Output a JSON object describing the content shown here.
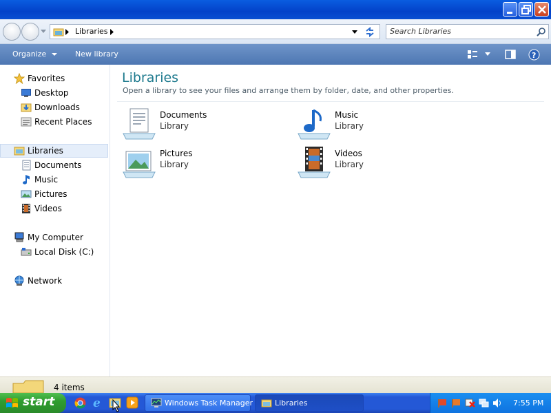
{
  "window": {
    "buttons": [
      "minimize",
      "maximize",
      "close"
    ]
  },
  "address": {
    "path_label": "Libraries",
    "search_placeholder": "Search Libraries"
  },
  "toolbar": {
    "organize_label": "Organize",
    "new_library_label": "New library"
  },
  "nav": {
    "favorites": "Favorites",
    "desktop": "Desktop",
    "downloads": "Downloads",
    "recent": "Recent Places",
    "libraries": "Libraries",
    "documents": "Documents",
    "music": "Music",
    "pictures": "Pictures",
    "videos": "Videos",
    "computer": "My Computer",
    "local_disk": "Local Disk (C:)",
    "network": "Network"
  },
  "content": {
    "title": "Libraries",
    "subtitle": "Open a library to see your files and arrange them by folder, date, and other properties.",
    "libraries": [
      {
        "name": "Documents",
        "type": "Library"
      },
      {
        "name": "Music",
        "type": "Library"
      },
      {
        "name": "Pictures",
        "type": "Library"
      },
      {
        "name": "Videos",
        "type": "Library"
      }
    ]
  },
  "status": {
    "item_count": "4 items"
  },
  "taskbar": {
    "start_label": "start",
    "tasks": [
      {
        "label": "Windows Task Manager"
      },
      {
        "label": "Libraries"
      }
    ],
    "clock": "7:55 PM"
  },
  "colors": {
    "title_bar": "#0342c9",
    "command_bar": "#4d76b2",
    "heading": "#1e7a8e",
    "start_button": "#2f9d2f",
    "taskbar": "#2458d6"
  }
}
